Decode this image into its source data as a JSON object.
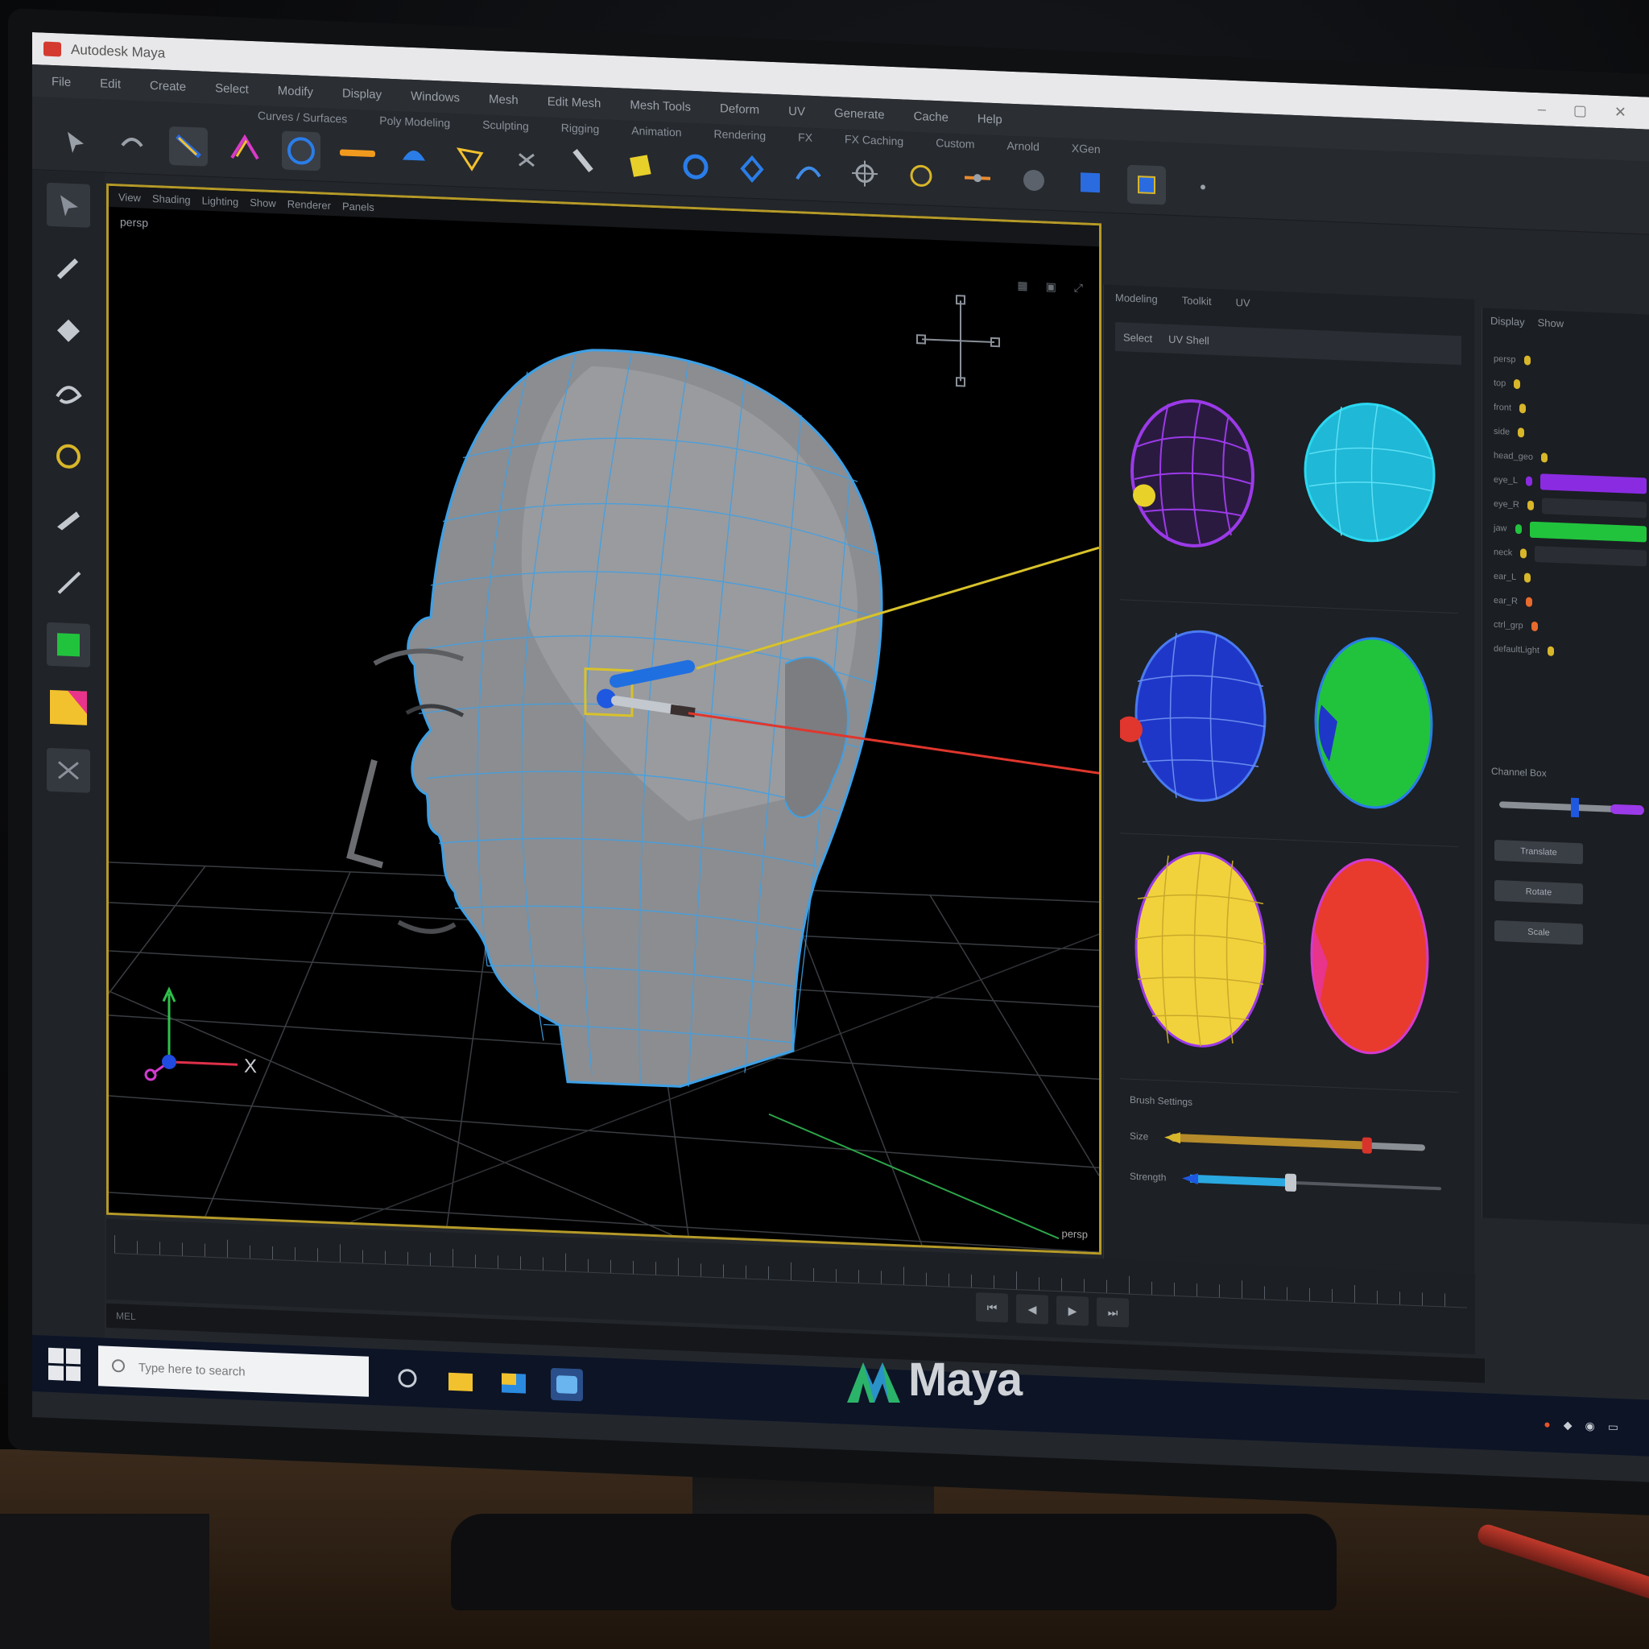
{
  "window": {
    "title": "Autodesk Maya",
    "controls": [
      "–",
      "▢",
      "✕"
    ]
  },
  "menubar": {
    "items": [
      "File",
      "Edit",
      "Create",
      "Select",
      "Modify",
      "Display",
      "Windows",
      "Mesh",
      "Edit Mesh",
      "Mesh Tools",
      "Deform",
      "UV",
      "Generate",
      "Cache",
      "Help"
    ]
  },
  "shelf": {
    "tabs": [
      "Curves / Surfaces",
      "Poly Modeling",
      "Sculpting",
      "Rigging",
      "Animation",
      "Rendering",
      "FX",
      "FX Caching",
      "Custom",
      "Arnold",
      "XGen"
    ]
  },
  "viewport": {
    "panel_menu": [
      "View",
      "Shading",
      "Lighting",
      "Show",
      "Renderer",
      "Panels"
    ],
    "camera_label": "persp",
    "axis_x": "X",
    "stats": "persp"
  },
  "panel": {
    "tabs": [
      "Modeling",
      "Toolkit",
      "UV"
    ],
    "header": [
      "Select",
      "UV Shell"
    ],
    "swatches": [
      {
        "name": "purple",
        "color": "#8a2be2"
      },
      {
        "name": "cyan",
        "color": "#1fb8d6"
      },
      {
        "name": "blue",
        "color": "#1f37c8"
      },
      {
        "name": "green",
        "color": "#21c33d"
      },
      {
        "name": "yellow",
        "color": "#f2d23c"
      },
      {
        "name": "red",
        "color": "#e83b2d"
      }
    ],
    "sliders_title": "Brush Settings",
    "slider_labels": [
      "Size",
      "Strength"
    ],
    "slider_values": [
      0.78,
      0.4
    ]
  },
  "outliner": {
    "header": [
      "Display",
      "Show"
    ],
    "rows": [
      {
        "label": "persp",
        "color": "#d8b62a",
        "bar": ""
      },
      {
        "label": "top",
        "color": "#d8b62a",
        "bar": ""
      },
      {
        "label": "front",
        "color": "#d8b62a",
        "bar": ""
      },
      {
        "label": "side",
        "color": "#d8b62a",
        "bar": ""
      },
      {
        "label": "head_geo",
        "color": "#d8b62a",
        "bar": ""
      },
      {
        "label": "eye_L",
        "color": "#8a2be2",
        "bar": "#8a2be2"
      },
      {
        "label": "eye_R",
        "color": "#d8b62a",
        "bar": "#2a2d33"
      },
      {
        "label": "jaw",
        "color": "#21c33d",
        "bar": "#21c33d"
      },
      {
        "label": "neck",
        "color": "#d8b62a",
        "bar": "#2a2d33"
      },
      {
        "label": "ear_L",
        "color": "#d8b62a",
        "bar": ""
      },
      {
        "label": "ear_R",
        "color": "#e86a2d",
        "bar": ""
      },
      {
        "label": "ctrl_grp",
        "color": "#e86a2d",
        "bar": ""
      },
      {
        "label": "defaultLight",
        "color": "#d8b62a",
        "bar": ""
      }
    ],
    "attr_header": "Channel Box",
    "attr_buttons": [
      "Translate",
      "Rotate",
      "Scale"
    ]
  },
  "timeline": {
    "controls": [
      "⏮",
      "◀",
      "▶",
      "⏭"
    ]
  },
  "cmdline": {
    "label": "MEL"
  },
  "taskbar": {
    "search_placeholder": "Type here to search"
  },
  "monitor": {
    "brand": "Maya"
  }
}
